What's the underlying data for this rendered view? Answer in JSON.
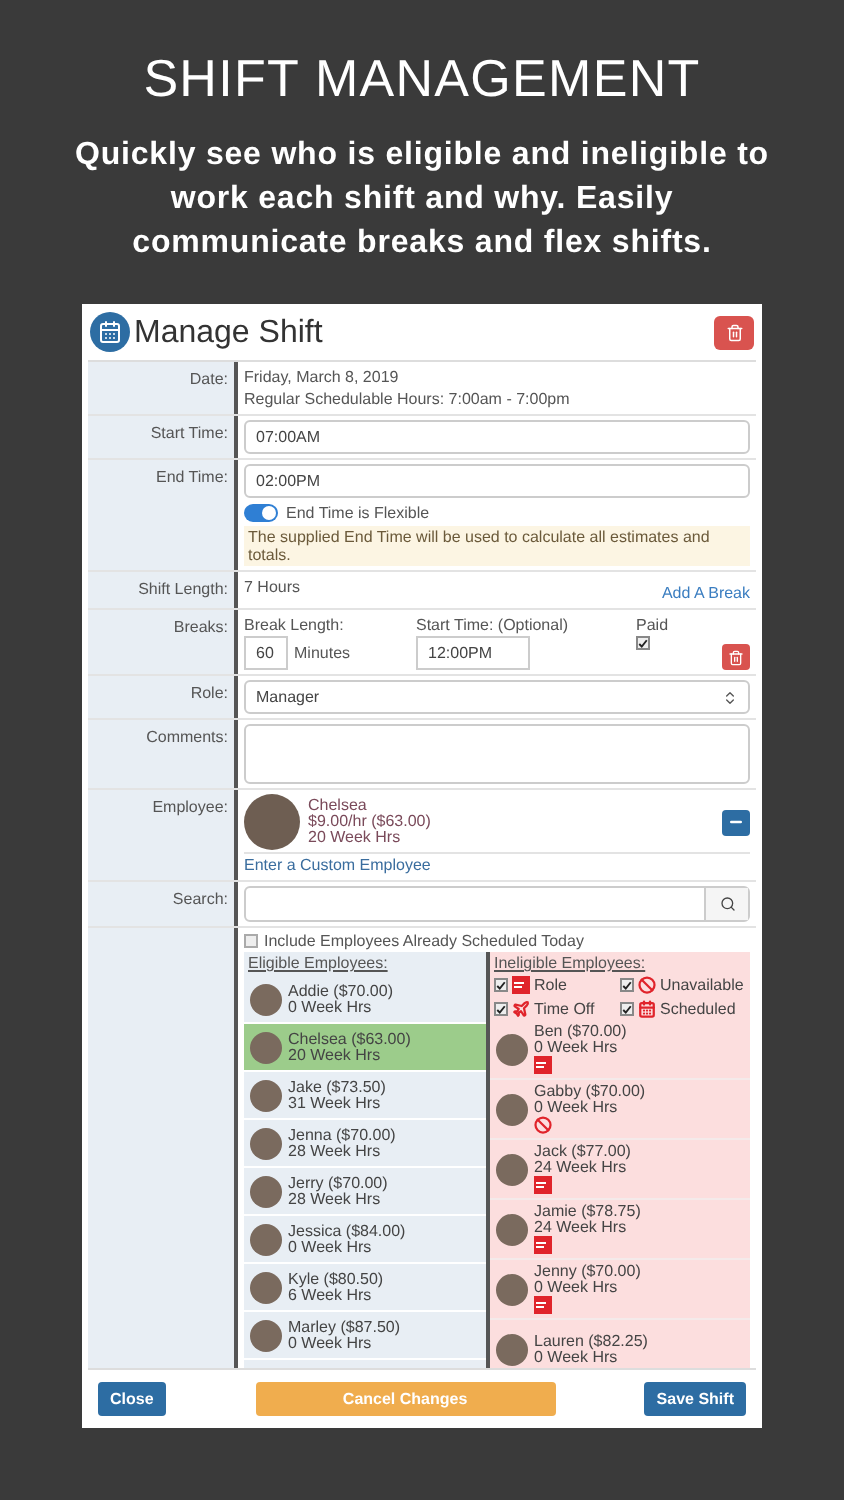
{
  "header": {
    "title": "SHIFT MANAGEMENT",
    "subtitle": "Quickly see who is eligible and ineligible to work each shift and why. Easily communicate breaks and flex shifts."
  },
  "dialog": {
    "title": "Manage Shift",
    "date": {
      "label": "Date:",
      "lines": [
        "Friday, March 8, 2019",
        "Regular Schedulable Hours: 7:00am - 7:00pm"
      ]
    },
    "start_time": {
      "label": "Start Time:",
      "value": "07:00AM"
    },
    "end_time": {
      "label": "End Time:",
      "value": "02:00PM",
      "flexible": {
        "label": "End Time is Flexible",
        "on": true
      },
      "notice": "The supplied End Time will be used to calculate all estimates and totals."
    },
    "shift_length": {
      "label": "Shift Length:",
      "value": "7 Hours",
      "link": "Add A Break"
    },
    "breaks": {
      "label": "Breaks:",
      "length_label": "Break Length:",
      "length_value": "60",
      "unit": "Minutes",
      "start_label": "Start Time: (Optional)",
      "start_value": "12:00PM",
      "paid_label": "Paid",
      "paid": true
    },
    "role": {
      "label": "Role:",
      "value": "Manager"
    },
    "comments": {
      "label": "Comments:"
    },
    "employee": {
      "label": "Employee:",
      "name": "Chelsea",
      "rate": "$9.00/hr ($63.00)",
      "hours": "20 Week Hrs",
      "link": "Enter a Custom Employee"
    },
    "search": {
      "label": "Search:"
    },
    "include_scheduled": {
      "label": "Include Employees Already Scheduled Today",
      "checked": false
    },
    "eligible": {
      "title": "Eligible Employees:",
      "items": [
        {
          "name": "Addie ($70.00)",
          "hours": "0 Week Hrs",
          "selected": false
        },
        {
          "name": "Chelsea ($63.00)",
          "hours": "20 Week Hrs",
          "selected": true
        },
        {
          "name": "Jake ($73.50)",
          "hours": "31 Week Hrs",
          "selected": false
        },
        {
          "name": "Jenna ($70.00)",
          "hours": "28 Week Hrs",
          "selected": false
        },
        {
          "name": "Jerry ($70.00)",
          "hours": "28 Week Hrs",
          "selected": false
        },
        {
          "name": "Jessica ($84.00)",
          "hours": "0 Week Hrs",
          "selected": false
        },
        {
          "name": "Kyle ($80.50)",
          "hours": "6 Week Hrs",
          "selected": false
        },
        {
          "name": "Marley ($87.50)",
          "hours": "0 Week Hrs",
          "selected": false
        }
      ]
    },
    "ineligible": {
      "title": "Ineligible Employees:",
      "filters": [
        {
          "kind": "role",
          "label": "Role",
          "checked": true
        },
        {
          "kind": "unavailable",
          "label": "Unavailable",
          "checked": true
        },
        {
          "kind": "timeoff",
          "label": "Time Off",
          "checked": true
        },
        {
          "kind": "scheduled",
          "label": "Scheduled",
          "checked": true
        }
      ],
      "items": [
        {
          "name": "Ben ($70.00)",
          "hours": "0 Week Hrs",
          "kind": "role"
        },
        {
          "name": "Gabby ($70.00)",
          "hours": "0 Week Hrs",
          "kind": "unavailable"
        },
        {
          "name": "Jack ($77.00)",
          "hours": "24 Week Hrs",
          "kind": "role"
        },
        {
          "name": "Jamie ($78.75)",
          "hours": "24 Week Hrs",
          "kind": "role"
        },
        {
          "name": "Jenny ($70.00)",
          "hours": "0 Week Hrs",
          "kind": "role"
        },
        {
          "name": "Lauren ($82.25)",
          "hours": "0 Week Hrs",
          "kind": "plain"
        }
      ]
    },
    "buttons": {
      "close": "Close",
      "cancel": "Cancel Changes",
      "save": "Save Shift"
    }
  }
}
